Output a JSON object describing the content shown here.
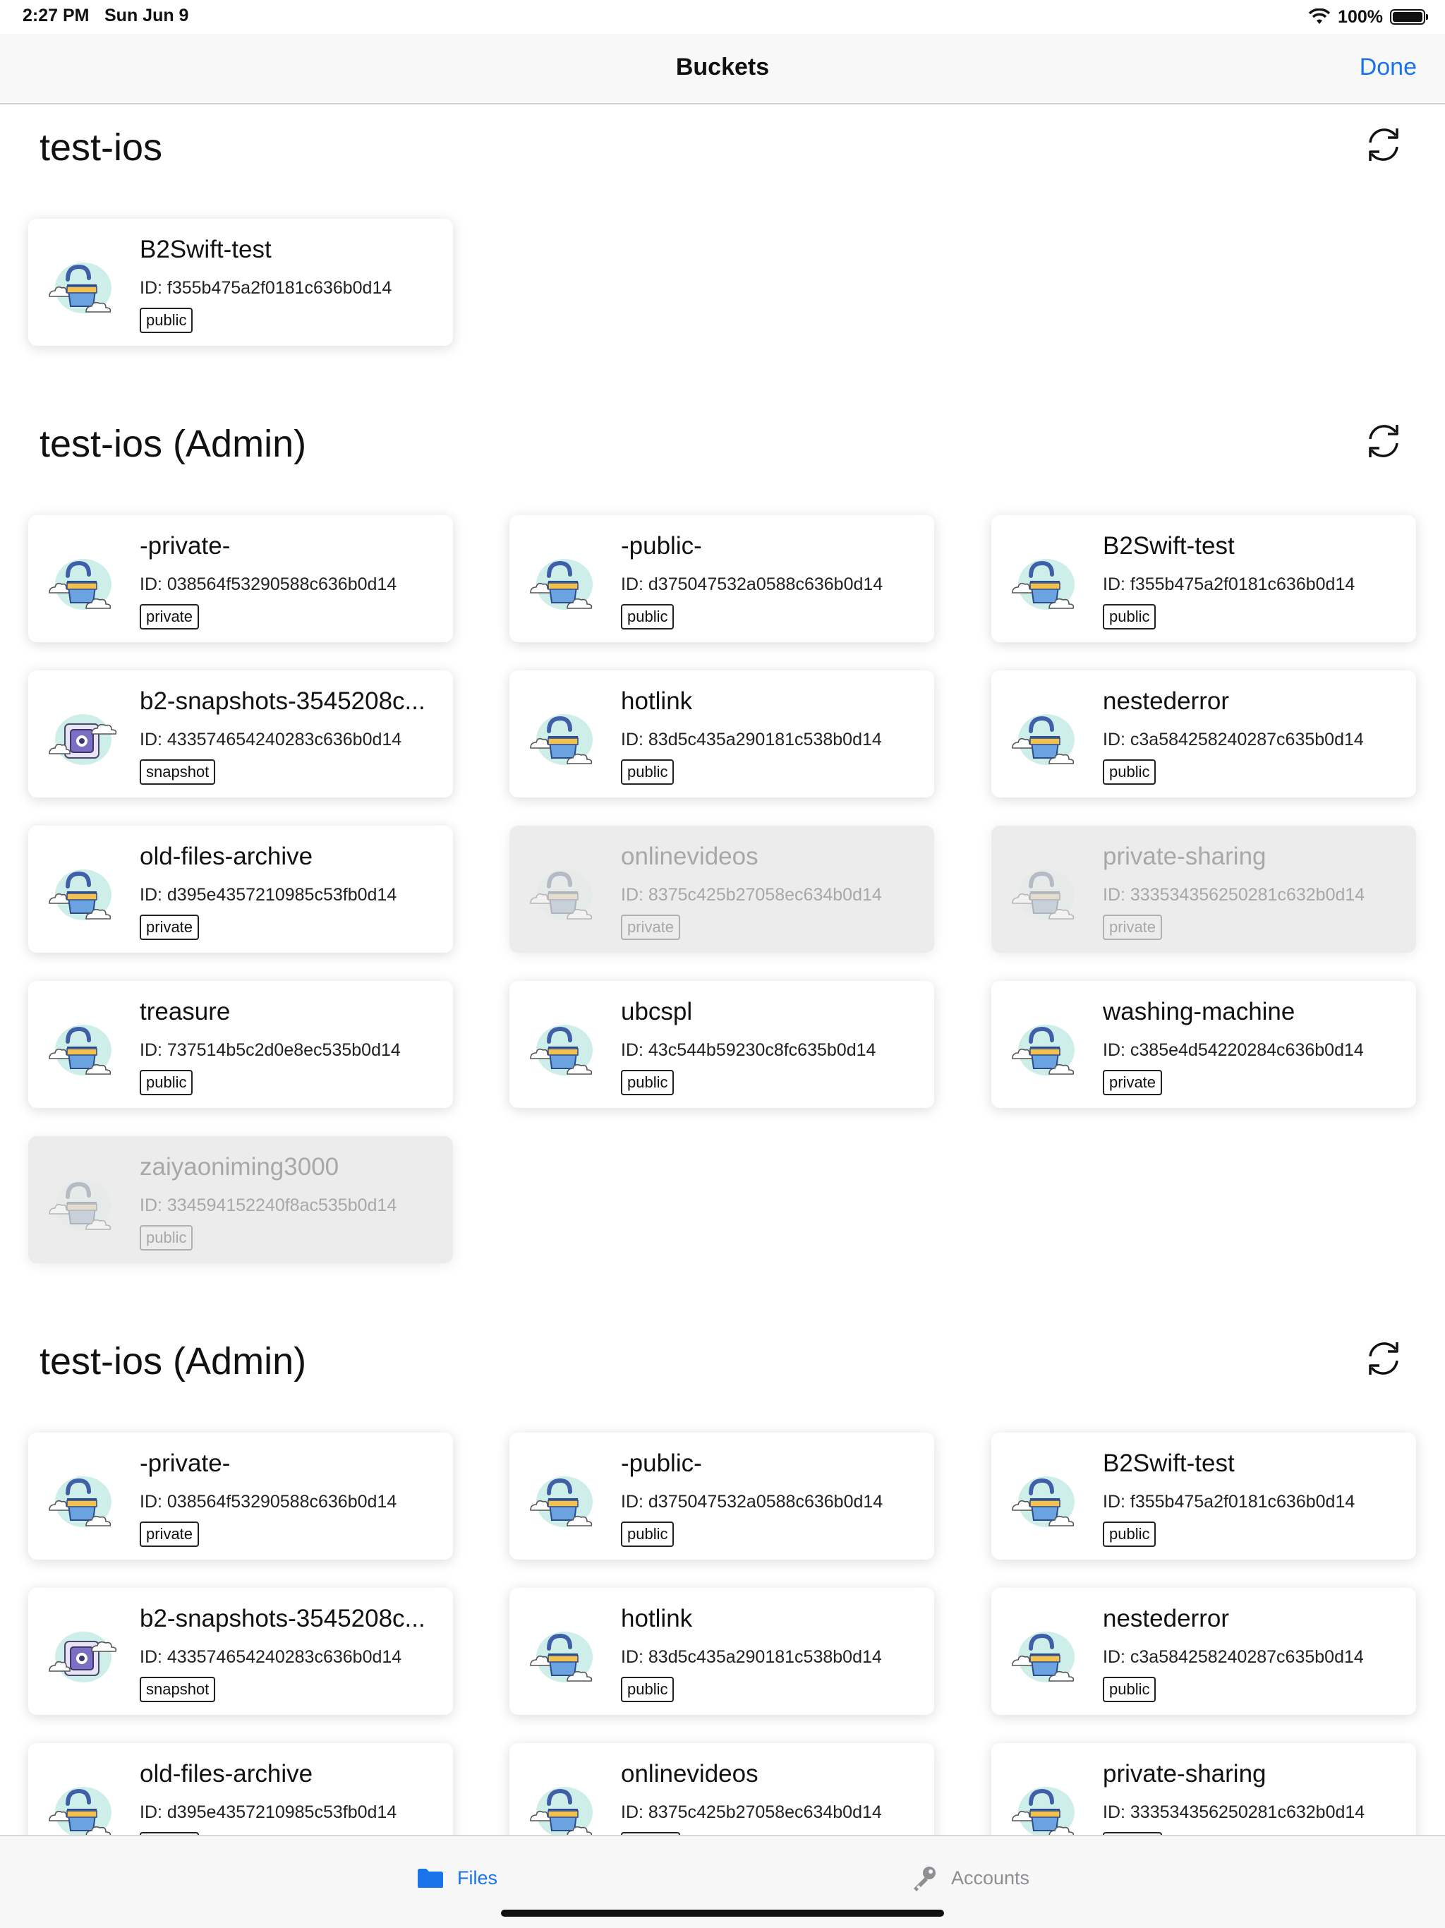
{
  "status": {
    "time": "2:27 PM",
    "date": "Sun Jun 9",
    "battery": "100%",
    "battery_level": 1.0
  },
  "nav": {
    "title": "Buckets",
    "done": "Done"
  },
  "sections": [
    {
      "title": "test-ios",
      "buckets": [
        {
          "name": "B2Swift-test",
          "id": "ID: f355b475a2f0181c636b0d14",
          "type": "public",
          "icon": "unlocked-bucket-cloud-icon",
          "disabled": false
        }
      ]
    },
    {
      "title": "test-ios (Admin)",
      "buckets": [
        {
          "name": "-private-",
          "id": "ID: 038564f53290588c636b0d14",
          "type": "private",
          "icon": "unlocked-bucket-cloud-icon",
          "disabled": false
        },
        {
          "name": "-public-",
          "id": "ID: d375047532a0588c636b0d14",
          "type": "public",
          "icon": "unlocked-bucket-cloud-icon",
          "disabled": false
        },
        {
          "name": "B2Swift-test",
          "id": "ID: f355b475a2f0181c636b0d14",
          "type": "public",
          "icon": "unlocked-bucket-cloud-icon",
          "disabled": false
        },
        {
          "name": "b2-snapshots-3545208c...",
          "id": "ID: 433574654240283c636b0d14",
          "type": "snapshot",
          "icon": "snapshot-bucket-cloud-icon",
          "disabled": false
        },
        {
          "name": "hotlink",
          "id": "ID: 83d5c435a290181c538b0d14",
          "type": "public",
          "icon": "unlocked-bucket-cloud-icon",
          "disabled": false
        },
        {
          "name": "nestederror",
          "id": "ID: c3a584258240287c635b0d14",
          "type": "public",
          "icon": "unlocked-bucket-cloud-icon",
          "disabled": false
        },
        {
          "name": "old-files-archive",
          "id": "ID: d395e4357210985c53fb0d14",
          "type": "private",
          "icon": "unlocked-bucket-cloud-icon",
          "disabled": false
        },
        {
          "name": "onlinevideos",
          "id": "ID: 8375c425b27058ec634b0d14",
          "type": "private",
          "icon": "unlocked-bucket-cloud-icon",
          "disabled": true
        },
        {
          "name": "private-sharing",
          "id": "ID: 333534356250281c632b0d14",
          "type": "private",
          "icon": "unlocked-bucket-cloud-icon",
          "disabled": true
        },
        {
          "name": "treasure",
          "id": "ID: 737514b5c2d0e8ec535b0d14",
          "type": "public",
          "icon": "unlocked-bucket-cloud-icon",
          "disabled": false
        },
        {
          "name": "ubcspl",
          "id": "ID: 43c544b59230c8fc635b0d14",
          "type": "public",
          "icon": "unlocked-bucket-cloud-icon",
          "disabled": false
        },
        {
          "name": "washing-machine",
          "id": "ID: c385e4d54220284c636b0d14",
          "type": "private",
          "icon": "unlocked-bucket-cloud-icon",
          "disabled": false
        },
        {
          "name": "zaiyaoniming3000",
          "id": "ID: 334594152240f8ac535b0d14",
          "type": "public",
          "icon": "unlocked-bucket-cloud-icon",
          "disabled": true
        }
      ]
    },
    {
      "title": "test-ios (Admin)",
      "buckets": [
        {
          "name": "-private-",
          "id": "ID: 038564f53290588c636b0d14",
          "type": "private",
          "icon": "unlocked-bucket-cloud-icon",
          "disabled": false
        },
        {
          "name": "-public-",
          "id": "ID: d375047532a0588c636b0d14",
          "type": "public",
          "icon": "unlocked-bucket-cloud-icon",
          "disabled": false
        },
        {
          "name": "B2Swift-test",
          "id": "ID: f355b475a2f0181c636b0d14",
          "type": "public",
          "icon": "unlocked-bucket-cloud-icon",
          "disabled": false
        },
        {
          "name": "b2-snapshots-3545208c...",
          "id": "ID: 433574654240283c636b0d14",
          "type": "snapshot",
          "icon": "snapshot-bucket-cloud-icon",
          "disabled": false
        },
        {
          "name": "hotlink",
          "id": "ID: 83d5c435a290181c538b0d14",
          "type": "public",
          "icon": "unlocked-bucket-cloud-icon",
          "disabled": false
        },
        {
          "name": "nestederror",
          "id": "ID: c3a584258240287c635b0d14",
          "type": "public",
          "icon": "unlocked-bucket-cloud-icon",
          "disabled": false
        },
        {
          "name": "old-files-archive",
          "id": "ID: d395e4357210985c53fb0d14",
          "type": "private",
          "icon": "unlocked-bucket-cloud-icon",
          "disabled": false
        },
        {
          "name": "onlinevideos",
          "id": "ID: 8375c425b27058ec634b0d14",
          "type": "private",
          "icon": "unlocked-bucket-cloud-icon",
          "disabled": false
        },
        {
          "name": "private-sharing",
          "id": "ID: 333534356250281c632b0d14",
          "type": "private",
          "icon": "unlocked-bucket-cloud-icon",
          "disabled": false
        }
      ]
    }
  ],
  "tabs": {
    "files": "Files",
    "accounts": "Accounts"
  },
  "colors": {
    "accent": "#1a73e8",
    "cloud": "#cdeee9",
    "bucket": "#6aa3e0",
    "stripe": "#f2c14e"
  }
}
